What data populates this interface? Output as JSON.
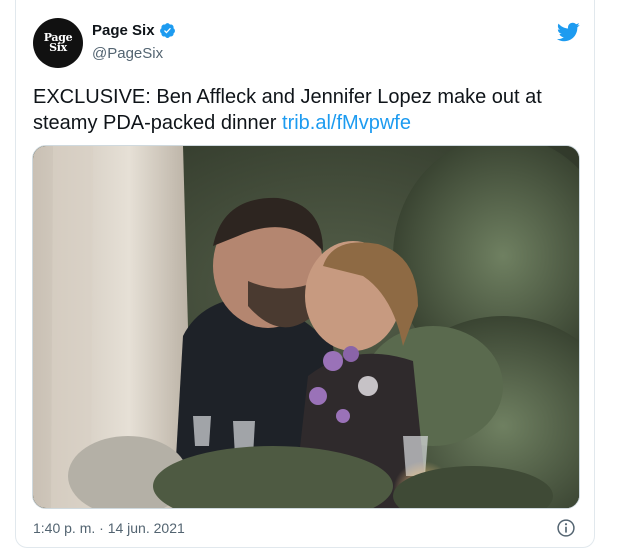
{
  "tweet": {
    "author_name": "Page Six",
    "author_handle": "@PageSix",
    "avatar_line1": "Page",
    "avatar_line2": "Six",
    "text": "EXCLUSIVE: Ben Affleck and Jennifer Lopez make out at steamy PDA-packed dinner ",
    "link_text": "trib.al/fMvpwfe",
    "timestamp": "1:40 p. m. · 14 jun. 2021"
  },
  "icons": {
    "verified": "verified-badge-icon",
    "twitter": "twitter-bird-icon",
    "info": "info-icon"
  },
  "colors": {
    "link": "#1d9bf0",
    "twitter_blue": "#1d9bf0",
    "text": "#0f1419",
    "secondary": "#536471"
  }
}
